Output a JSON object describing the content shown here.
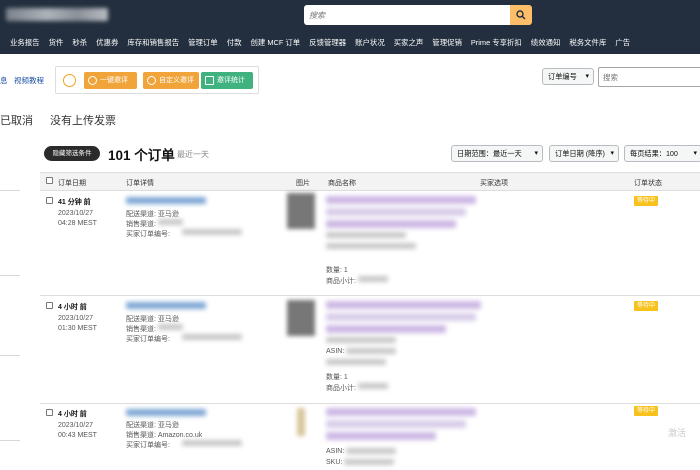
{
  "header": {
    "search_placeholder": "搜索"
  },
  "nav": [
    "业务报告",
    "货件",
    "秒杀",
    "优惠券",
    "库存和销售报告",
    "管理订单",
    "付款",
    "创建 MCF 订单",
    "反馈管理器",
    "账户状况",
    "买家之声",
    "管理促销",
    "Prime 专享折扣",
    "绩效通知",
    "税务文件库",
    "广告"
  ],
  "toolbar": {
    "left_link_1": "息",
    "left_link_2": "视频教程",
    "btn_one_click": "一键邀评",
    "btn_custom": "自定义邀评",
    "btn_stats": "邀评统计",
    "select_field": "订单编号",
    "search_placeholder": "搜索"
  },
  "tabs": [
    "已取消",
    "没有上传发票"
  ],
  "summary": {
    "filter_pill": "隐藏筛选条件",
    "count": "101 个订单",
    "range": "最近一天"
  },
  "filters": {
    "date_range": "日期范围：最近一天",
    "sort": "订单日期 (降序)",
    "per_page": "每页结果：100"
  },
  "table": {
    "headers": [
      "订单日期",
      "订单详情",
      "图片",
      "商品名称",
      "买家选项",
      "订单状态"
    ],
    "labels": {
      "qty": "数量: 1",
      "subtotal": "商品小计:",
      "asin": "ASIN:",
      "sku": "SKU:"
    },
    "rows": [
      {
        "ago": "41 分钟 前",
        "date": "2023/10/27",
        "time": "04:28 MEST",
        "ship": "配送渠道: 亚马逊",
        "channel": "销售渠道:",
        "buyer": "买家订单编号:",
        "status": "等待中"
      },
      {
        "ago": "4 小时 前",
        "date": "2023/10/27",
        "time": "01:30 MEST",
        "ship": "配送渠道: 亚马逊",
        "channel": "销售渠道:",
        "buyer": "买家订单编号:",
        "status": "等待中"
      },
      {
        "ago": "4 小时 前",
        "date": "2023/10/27",
        "time": "00:43 MEST",
        "ship": "配送渠道: 亚马逊",
        "channel": "销售渠道: Amazon.co.uk",
        "buyer": "买家订单编号:",
        "status": "等待中"
      }
    ]
  },
  "watermark": "激活"
}
